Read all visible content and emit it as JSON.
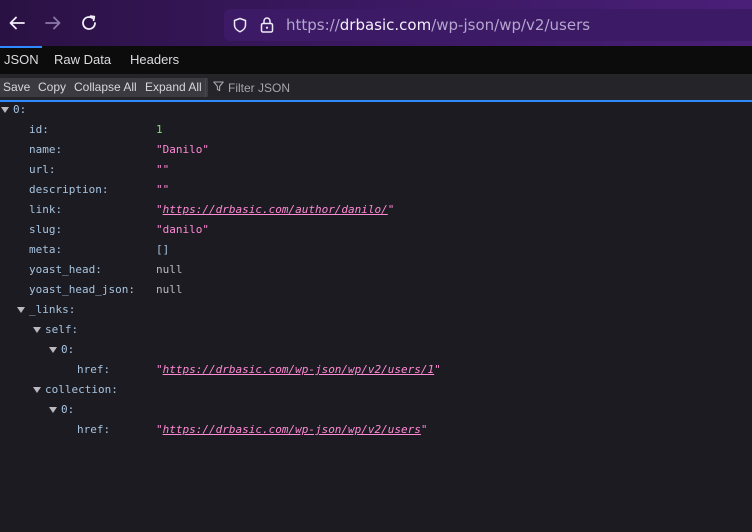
{
  "browser": {
    "url_prefix": "https://",
    "url_domain": "drbasic.com",
    "url_path": "/wp-json/wp/v2/users"
  },
  "viewer": {
    "tabs": [
      "JSON",
      "Raw Data",
      "Headers"
    ],
    "buttons": [
      "Save",
      "Copy",
      "Collapse All",
      "Expand All"
    ],
    "filter_placeholder": "Filter JSON"
  },
  "tree": {
    "root_index": "0:",
    "fields": {
      "id": {
        "key": "id:",
        "value": "1"
      },
      "name": {
        "key": "name:",
        "value": "Danilo"
      },
      "url": {
        "key": "url:",
        "value": ""
      },
      "description": {
        "key": "description:",
        "value": ""
      },
      "link": {
        "key": "link:",
        "value": "https://drbasic.com/author/danilo/"
      },
      "slug": {
        "key": "slug:",
        "value": "danilo"
      },
      "meta": {
        "key": "meta:",
        "value": "[]"
      },
      "yoast_head": {
        "key": "yoast_head:",
        "value": "null"
      },
      "yoast_head_json": {
        "key": "yoast_head_json:",
        "value": "null"
      }
    },
    "links": {
      "key": "_links:",
      "self_key": "self:",
      "self_index": "0:",
      "self_href_key": "href:",
      "self_href": "https://drbasic.com/wp-json/wp/v2/users/1",
      "collection_key": "collection:",
      "collection_index": "0:",
      "collection_href_key": "href:",
      "collection_href": "https://drbasic.com/wp-json/wp/v2/users"
    }
  },
  "colors": {
    "toolbar_gradient": [
      "#2a1143",
      "#4a1f78"
    ],
    "accent": "#2f89ff",
    "json_key": "#a7c4e0",
    "json_string": "#ff8ad4",
    "json_number": "#86de74"
  }
}
